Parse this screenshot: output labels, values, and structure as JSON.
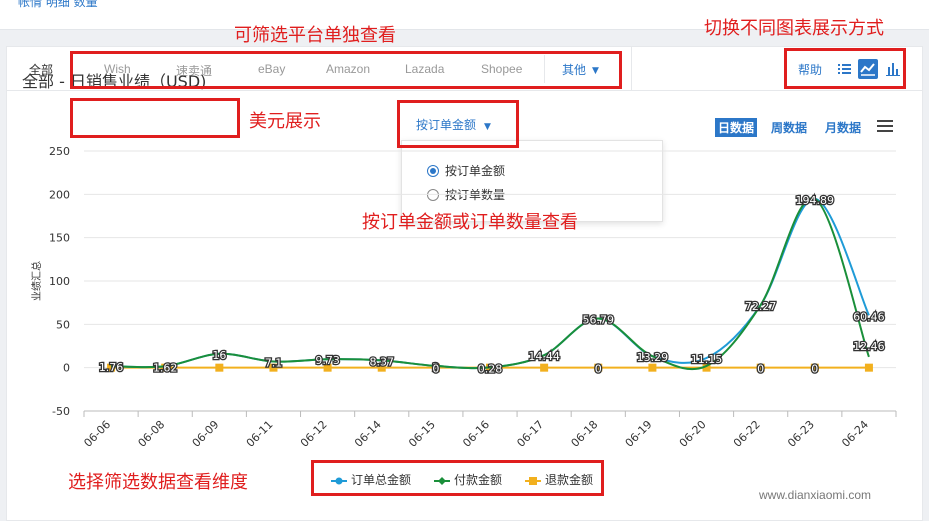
{
  "topstrip": {
    "cut_text": "帐情 明细 数量"
  },
  "platforms": {
    "all": "全部",
    "items": [
      "Wish",
      "速卖通",
      "eBay",
      "Amazon",
      "Lazada",
      "Shopee"
    ],
    "more": "其他"
  },
  "toolbar": {
    "help": "帮助",
    "view_icons": [
      "list-icon",
      "line-chart-icon",
      "bar-chart-icon"
    ],
    "active_view": "line-chart-icon"
  },
  "chart_header": {
    "title": "全部 - 日销售业绩（USD)",
    "metric_selected": "按订单金额",
    "metric_options": [
      "按订单金额",
      "按订单数量"
    ],
    "periods": [
      "日数据",
      "周数据",
      "月数据"
    ],
    "active_period": "日数据"
  },
  "annotations": {
    "platform_filter": "可筛选平台单独查看",
    "switch_chart": "切换不同图表展示方式",
    "usd": "美元展示",
    "metric": "按订单金额或订单数量查看",
    "dimension": "选择筛选数据查看维度"
  },
  "watermark": "www.dianxiaomi.com",
  "colors": {
    "accent": "#2c77c8",
    "order_total": "#1f9bd7",
    "paid": "#1a8f3a",
    "refund": "#f2b01e",
    "annotation": "#e01e1e"
  },
  "chart_data": {
    "type": "line",
    "ylabel": "业绩汇总",
    "ylim": [
      -50,
      250
    ],
    "yticks": [
      -50,
      0,
      50,
      100,
      150,
      200,
      250
    ],
    "categories": [
      "06-06",
      "06-08",
      "06-09",
      "06-11",
      "06-12",
      "06-14",
      "06-15",
      "06-16",
      "06-17",
      "06-18",
      "06-19",
      "06-20",
      "06-22",
      "06-23",
      "06-24"
    ],
    "series": [
      {
        "name": "订单总金额",
        "values": [
          1.76,
          1.62,
          16,
          7.1,
          9.73,
          8.37,
          2,
          0.28,
          14.44,
          56.79,
          13.29,
          11.15,
          72.27,
          194.89,
          60.46
        ]
      },
      {
        "name": "付款金额",
        "values": [
          1.76,
          1.62,
          16,
          7.1,
          9.73,
          8.37,
          2,
          0.28,
          14.44,
          56.79,
          13.29,
          2,
          72.27,
          194.89,
          12.46
        ]
      },
      {
        "name": "退款金额",
        "values": [
          0,
          0,
          0,
          0,
          0,
          0,
          0,
          0,
          0,
          0,
          0,
          0,
          0,
          0,
          0
        ]
      }
    ],
    "data_labels": [
      "1.76",
      "1.62",
      "16",
      "7.1",
      "9.73",
      "8.37",
      "2",
      "0.28",
      "14.44",
      "56.79",
      "13.29",
      "11.15",
      "72.27",
      "194.89",
      "60.46",
      "12.46"
    ],
    "refund_labels": [
      "0",
      "0",
      "0",
      "0",
      "0"
    ],
    "legend": "bottom-center",
    "grid": true
  }
}
